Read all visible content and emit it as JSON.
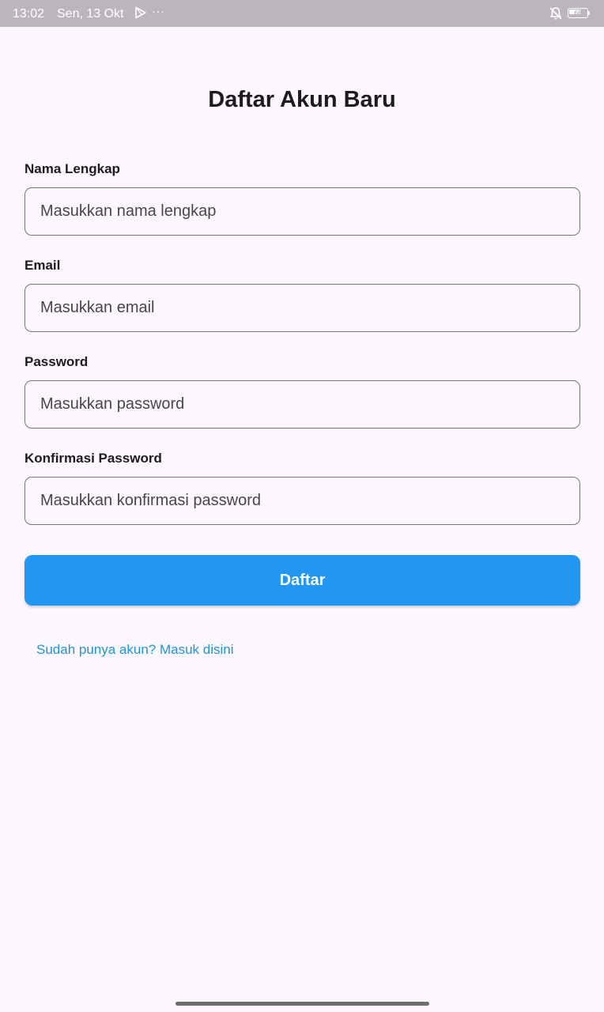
{
  "status_bar": {
    "time": "13:02",
    "date": "Sen, 13 Okt",
    "more": "···",
    "battery_level": "68"
  },
  "page": {
    "title": "Daftar Akun Baru"
  },
  "form": {
    "fields": [
      {
        "label": "Nama Lengkap",
        "placeholder": "Masukkan nama lengkap",
        "value": ""
      },
      {
        "label": "Email",
        "placeholder": "Masukkan email",
        "value": ""
      },
      {
        "label": "Password",
        "placeholder": "Masukkan password",
        "value": ""
      },
      {
        "label": "Konfirmasi Password",
        "placeholder": "Masukkan konfirmasi password",
        "value": ""
      }
    ],
    "submit_label": "Daftar",
    "login_link": "Sudah punya akun? Masuk disini"
  },
  "colors": {
    "background": "#fcf6fd",
    "primary": "#2196f3",
    "link": "#2196d3",
    "status_bar": "#bbb6bd"
  },
  "icons": {
    "status_play": "play-store-icon",
    "status_bell": "bell-muted-icon",
    "battery": "battery-icon"
  }
}
